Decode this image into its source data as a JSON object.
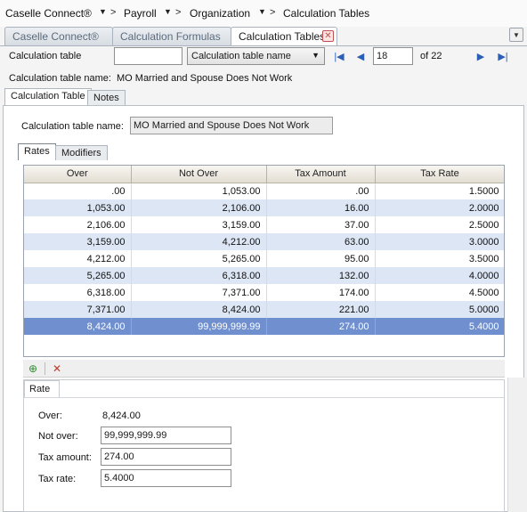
{
  "breadcrumb": {
    "items": [
      "Caselle Connect®",
      "Payroll",
      "Organization",
      "Calculation Tables"
    ],
    "separator": ">"
  },
  "doc_tabs": [
    {
      "label": "Caselle Connect®",
      "active": false
    },
    {
      "label": "Calculation Formulas",
      "active": false
    },
    {
      "label": "Calculation Tables",
      "active": true
    }
  ],
  "toolbar": {
    "calc_table_label": "Calculation table",
    "calc_table_value": "",
    "lookup_select": "Calculation table name",
    "record_number": "18",
    "record_total": "of 22"
  },
  "header": {
    "name_label": "Calculation table name:",
    "name_value": "MO Married and Spouse Does Not Work"
  },
  "subtabs": [
    "Calculation Table",
    "Notes"
  ],
  "form": {
    "name_label": "Calculation table name:",
    "name_value": "MO Married and Spouse Does Not Work"
  },
  "inner_tabs": [
    "Rates",
    "Modifiers"
  ],
  "rates_table": {
    "columns": [
      "Over",
      "Not Over",
      "Tax Amount",
      "Tax Rate"
    ],
    "rows": [
      [
        ".00",
        "1,053.00",
        ".00",
        "1.5000"
      ],
      [
        "1,053.00",
        "2,106.00",
        "16.00",
        "2.0000"
      ],
      [
        "2,106.00",
        "3,159.00",
        "37.00",
        "2.5000"
      ],
      [
        "3,159.00",
        "4,212.00",
        "63.00",
        "3.0000"
      ],
      [
        "4,212.00",
        "5,265.00",
        "95.00",
        "3.5000"
      ],
      [
        "5,265.00",
        "6,318.00",
        "132.00",
        "4.0000"
      ],
      [
        "6,318.00",
        "7,371.00",
        "174.00",
        "4.5000"
      ],
      [
        "7,371.00",
        "8,424.00",
        "221.00",
        "5.0000"
      ],
      [
        "8,424.00",
        "99,999,999.99",
        "274.00",
        "5.4000"
      ]
    ]
  },
  "rate_panel": {
    "tab": "Rate",
    "over_label": "Over:",
    "over_value": "8,424.00",
    "not_over_label": "Not over:",
    "not_over_value": "99,999,999.99",
    "tax_amount_label": "Tax amount:",
    "tax_amount_value": "274.00",
    "tax_rate_label": "Tax rate:",
    "tax_rate_value": "5.4000"
  },
  "colors": {
    "selected_row": "#6f8fcf",
    "alt_row": "#dde6f4",
    "nav_blue": "#2b5eb5",
    "close_red": "#c0504d"
  }
}
